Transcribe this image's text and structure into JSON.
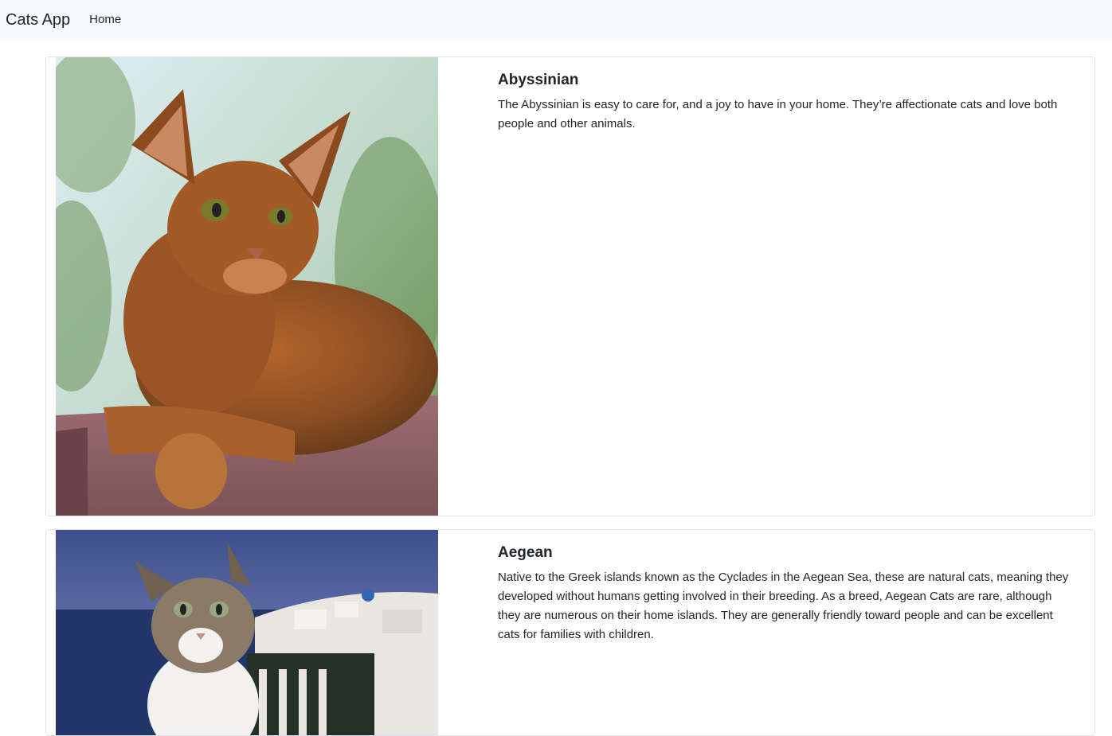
{
  "navbar": {
    "brand": "Cats App",
    "links": [
      {
        "label": "Home"
      }
    ]
  },
  "cats": [
    {
      "name": "Abyssinian",
      "description": "The Abyssinian is easy to care for, and a joy to have in your home. They’re affectionate cats and love both people and other animals.",
      "image_icon": "abyssinian-cat-photo"
    },
    {
      "name": "Aegean",
      "description": "Native to the Greek islands known as the Cyclades in the Aegean Sea, these are natural cats, meaning they developed without humans getting involved in their breeding. As a breed, Aegean Cats are rare, although they are numerous on their home islands. They are generally friendly toward people and can be excellent cats for families with children.",
      "image_icon": "aegean-cat-photo"
    }
  ]
}
